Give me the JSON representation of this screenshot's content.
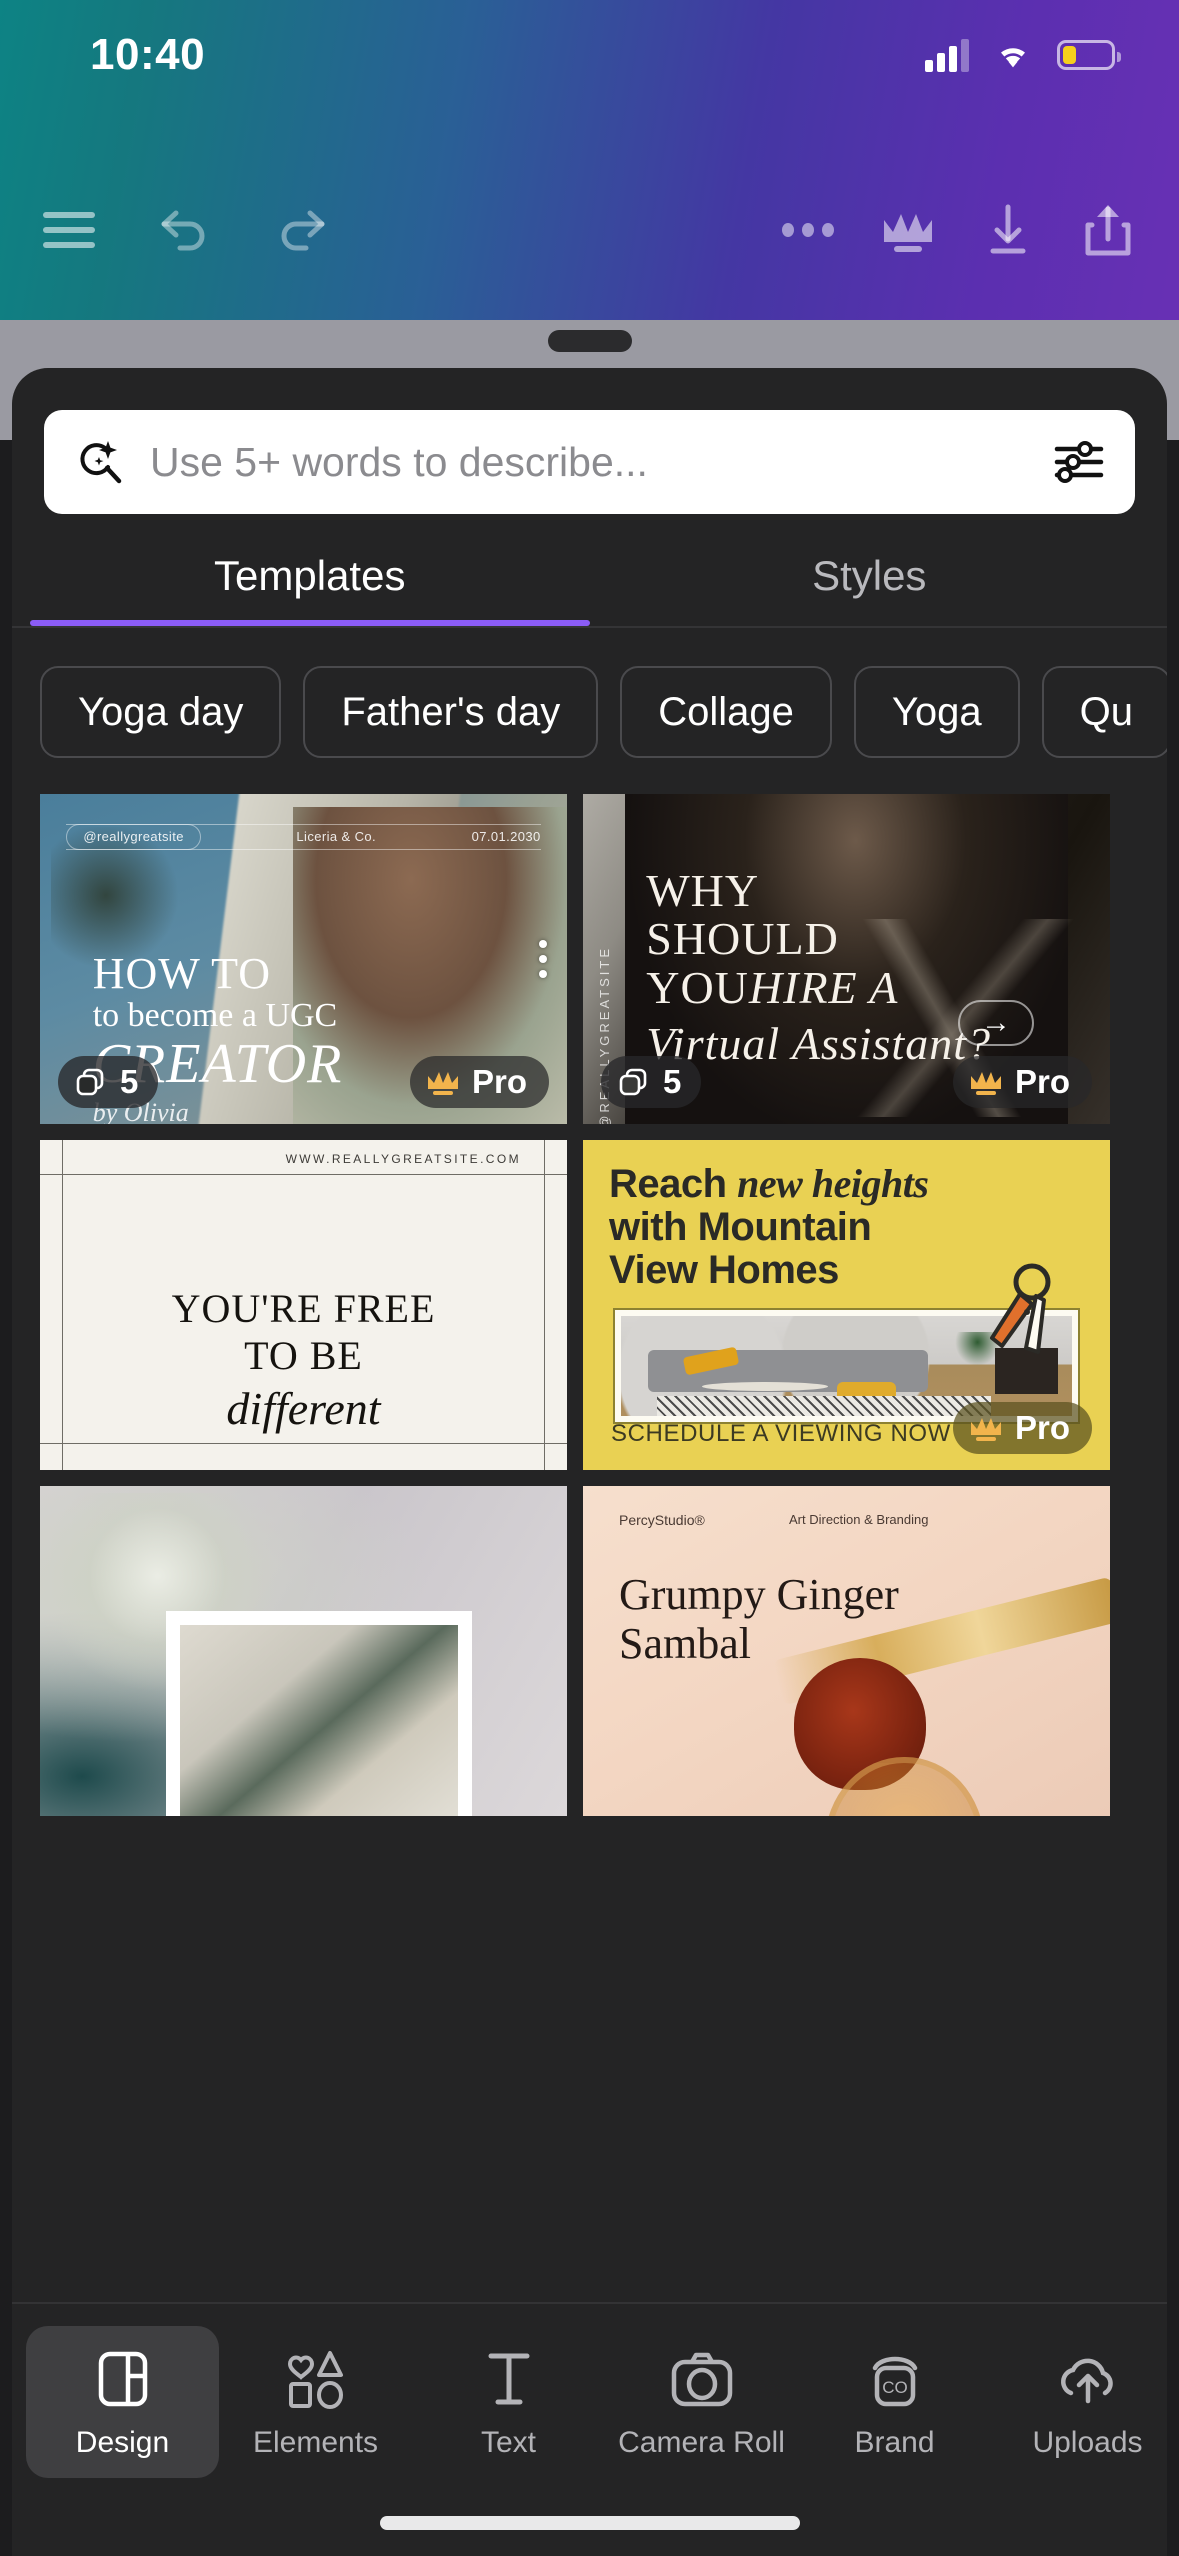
{
  "status_bar": {
    "time": "10:40",
    "signal_icon": "cellular-signal-icon",
    "wifi_icon": "wifi-icon",
    "battery_icon": "battery-low-icon",
    "battery_color": "#f5cf1d"
  },
  "editor_toolbar": {
    "menu_label": "hamburger-menu-icon",
    "undo_label": "undo-icon",
    "redo_label": "redo-icon",
    "more_label": "more-options-icon",
    "pro_label": "crown-pro-icon",
    "download_label": "download-icon",
    "share_label": "share-icon"
  },
  "search": {
    "placeholder": "Use 5+ words to describe...",
    "value": "",
    "leading_icon": "magic-search-icon",
    "trailing_icon": "filter-sliders-icon"
  },
  "tabs": [
    {
      "label": "Templates",
      "active": true
    },
    {
      "label": "Styles",
      "active": false
    }
  ],
  "active_tab_color": "#8b5cf6",
  "chips": [
    {
      "label": "Yoga day"
    },
    {
      "label": "Father's day"
    },
    {
      "label": "Collage"
    },
    {
      "label": "Yoga"
    },
    {
      "label": "Qu"
    }
  ],
  "templates": [
    {
      "id": "ugc-creator",
      "pages_badge": "5",
      "pro_badge": "Pro",
      "has_menu_dots": true,
      "has_arrow_button": false,
      "text": {
        "handle": "@reallygreatsite",
        "brand": "Liceria & Co.",
        "date": "07.01.2030",
        "line1": "HOW TO",
        "line2": "to become a UGC",
        "line3": "CREATOR",
        "signature": "by Olivia"
      }
    },
    {
      "id": "virtual-assistant",
      "pages_badge": "5",
      "pro_badge": "Pro",
      "has_menu_dots": false,
      "has_arrow_button": true,
      "arrow_glyph": "→",
      "text": {
        "vertical": "@REALLYGREATSITE",
        "line1": "WHY",
        "line2": "SHOULD",
        "line3_plain": "YOU",
        "line3_italic": "HIRE A",
        "line4": "Virtual Assistant?"
      }
    },
    {
      "id": "youre-free",
      "pages_badge": "",
      "pro_badge": "",
      "has_menu_dots": false,
      "has_arrow_button": false,
      "text": {
        "site": "WWW.REALLYGREATSITE.COM",
        "line1": "YOU'RE FREE",
        "line2": "TO BE",
        "line3": "different"
      }
    },
    {
      "id": "mountain-view-homes",
      "pages_badge": "",
      "pro_badge": "Pro",
      "has_menu_dots": false,
      "has_arrow_button": false,
      "background_color": "#e9d153",
      "text": {
        "head_1": "Reach ",
        "head_italic": "new heights",
        "head_2": "with Mountain",
        "head_3": "View Homes",
        "cta": "SCHEDULE A VIEWING NOW"
      }
    },
    {
      "id": "soft-flowers-frame",
      "pages_badge": "",
      "pro_badge": "",
      "has_menu_dots": false,
      "has_arrow_button": false,
      "text": {}
    },
    {
      "id": "grumpy-ginger-sambal",
      "pages_badge": "",
      "pro_badge": "",
      "has_menu_dots": false,
      "has_arrow_button": false,
      "text": {
        "brand": "PercyStudio®",
        "role": "Art Direction & Branding",
        "title_1": "Grumpy Ginger",
        "title_2": "Sambal"
      }
    }
  ],
  "bottom_nav": [
    {
      "label": "Design",
      "icon": "design-layout-icon",
      "active": true
    },
    {
      "label": "Elements",
      "icon": "shapes-icon",
      "active": false
    },
    {
      "label": "Text",
      "icon": "text-t-icon",
      "active": false
    },
    {
      "label": "Camera Roll",
      "icon": "camera-icon",
      "active": false
    },
    {
      "label": "Brand",
      "icon": "brand-tag-icon",
      "active": false
    },
    {
      "label": "Uploads",
      "icon": "upload-cloud-icon",
      "active": false
    }
  ]
}
